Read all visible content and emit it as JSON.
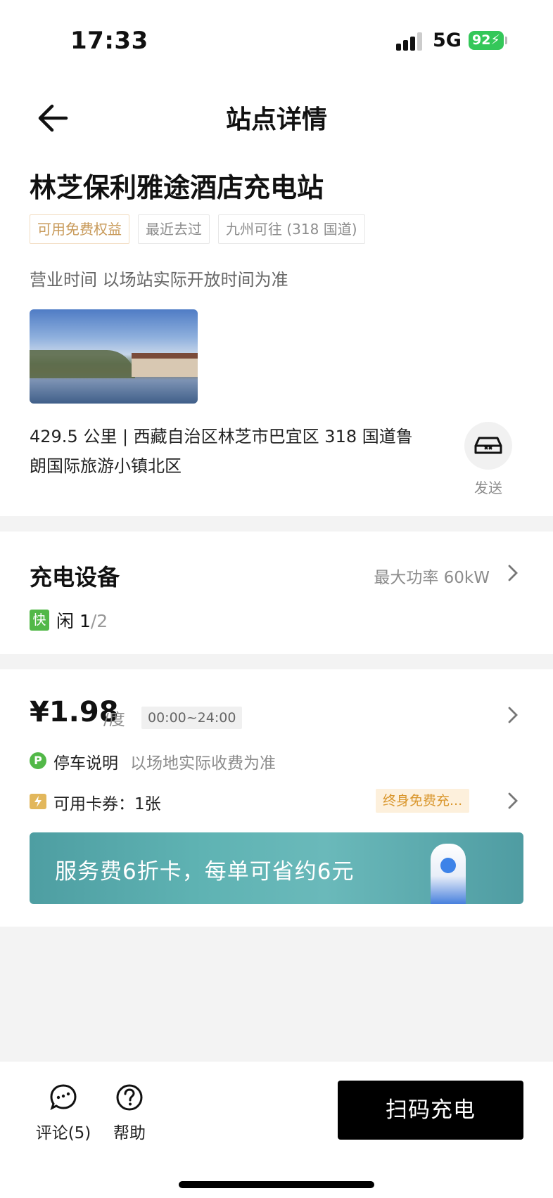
{
  "status_bar": {
    "time": "17:33",
    "network": "5G",
    "battery": "92"
  },
  "header": {
    "title": "站点详情"
  },
  "station": {
    "name": "林芝保利雅途酒店充电站",
    "tags": [
      "可用免费权益",
      "最近去过",
      "九州可往 (318 国道)"
    ],
    "hours": "营业时间 以场站实际开放时间为准",
    "address": "429.5 公里 | 西藏自治区林芝市巴宜区 318 国道鲁朗国际旅游小镇北区",
    "send_label": "发送"
  },
  "equipment": {
    "title": "充电设备",
    "max_power": "最大功率 60kW",
    "fast_label": "快",
    "idle_label": "闲",
    "idle_count": "1",
    "total_count": "/2"
  },
  "pricing": {
    "price": "¥1.98",
    "unit": "/度",
    "time_range": "00:00~24:00",
    "parking_badge": "P",
    "parking_title": "停车说明",
    "parking_desc": "以场地实际收费为准",
    "coupon_text": "可用卡券：1张",
    "coupon_tag": "终身免费充...",
    "promo_text": "服务费6折卡，每单可省约6元"
  },
  "bottom_bar": {
    "comment_label": "评论(5)",
    "help_label": "帮助",
    "scan_button": "扫码充电"
  },
  "colors": {
    "accent_green": "#52b848",
    "battery_green": "#34c759",
    "gold": "#c89a5a",
    "primary_button": "#000000"
  }
}
